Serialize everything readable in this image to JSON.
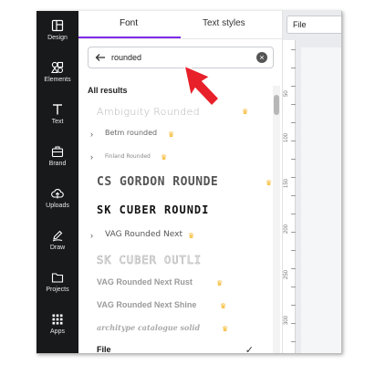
{
  "rail": {
    "items": [
      {
        "label": "Design",
        "icon": "layout-icon"
      },
      {
        "label": "Elements",
        "icon": "shapes-icon"
      },
      {
        "label": "Text",
        "icon": "text-icon"
      },
      {
        "label": "Brand",
        "icon": "briefcase-icon"
      },
      {
        "label": "Uploads",
        "icon": "cloud-upload-icon"
      },
      {
        "label": "Draw",
        "icon": "pen-icon"
      },
      {
        "label": "Projects",
        "icon": "folder-icon"
      },
      {
        "label": "Apps",
        "icon": "grid-icon"
      }
    ]
  },
  "panel": {
    "tabs": [
      {
        "label": "Font",
        "active": true
      },
      {
        "label": "Text styles",
        "active": false
      }
    ],
    "search": {
      "value": "rounded"
    },
    "section_title": "All results",
    "fonts": [
      {
        "name": "Ambiguity Rounded",
        "premium": true,
        "expandable": false
      },
      {
        "name": "Betm rounded",
        "premium": true,
        "expandable": true
      },
      {
        "name": "Finland Rounded",
        "premium": true,
        "expandable": true
      },
      {
        "name": "CS GORDON ROUNDE",
        "premium": true,
        "expandable": false
      },
      {
        "name": "SK CUBER ROUNDI",
        "premium": false,
        "expandable": false
      },
      {
        "name": "VAG Rounded Next",
        "premium": true,
        "expandable": true
      },
      {
        "name": "SK CUBER OUTLI",
        "premium": false,
        "expandable": false
      },
      {
        "name": "VAG Rounded Next Rust",
        "premium": true,
        "expandable": false
      },
      {
        "name": "VAG Rounded Next Shine",
        "premium": true,
        "expandable": false
      },
      {
        "name": "architype catalogue solid",
        "premium": true,
        "expandable": false
      },
      {
        "name": "File",
        "premium": false,
        "expandable": false,
        "selected": true
      }
    ]
  },
  "editor": {
    "font_box": "File",
    "ruler_labels": [
      "50",
      "100",
      "150",
      "200",
      "250",
      "300"
    ]
  },
  "colors": {
    "rail_bg": "#18191b",
    "accent": "#7d2ae8",
    "crown": "#f5b21c",
    "annotation_arrow": "#e8202a"
  }
}
